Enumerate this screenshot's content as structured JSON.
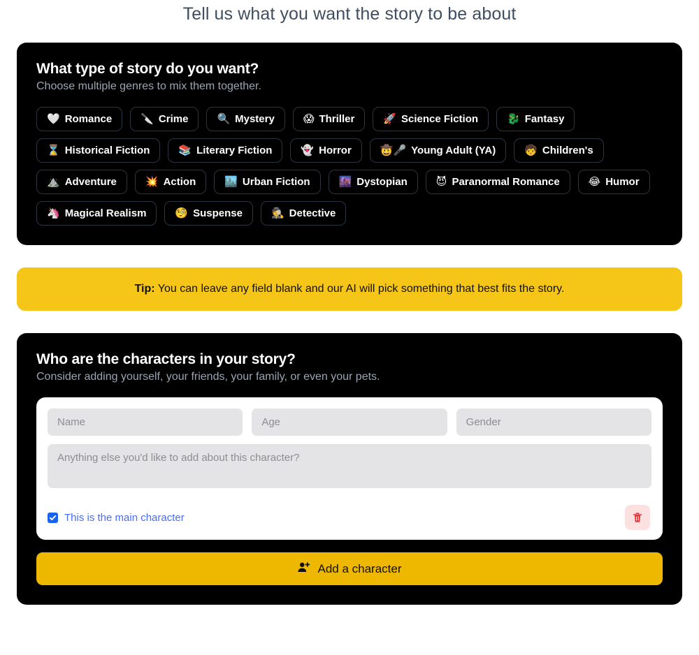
{
  "page": {
    "title": "Tell us what you want the story to be about",
    "background_color": "#ffffff",
    "title_color": "#3f4e60"
  },
  "genre_card": {
    "title": "What type of story do you want?",
    "subtitle": "Choose multiple genres to mix them together.",
    "background_color": "#000000",
    "chip_border_color": "#2c3442",
    "genres": [
      {
        "label": "Romance",
        "emoji": "🤍",
        "icon_name": "white-heart-icon"
      },
      {
        "label": "Crime",
        "emoji": "🔪",
        "icon_name": "knife-icon"
      },
      {
        "label": "Mystery",
        "emoji": "🔍",
        "icon_name": "magnifying-glass-icon"
      },
      {
        "label": "Thriller",
        "emoji": "😱",
        "icon_name": "screaming-face-icon"
      },
      {
        "label": "Science Fiction",
        "emoji": "🚀",
        "icon_name": "rocket-icon"
      },
      {
        "label": "Fantasy",
        "emoji": "🐉",
        "icon_name": "dragon-icon"
      },
      {
        "label": "Historical Fiction",
        "emoji": "⌛",
        "icon_name": "hourglass-icon"
      },
      {
        "label": "Literary Fiction",
        "emoji": "📚",
        "icon_name": "books-icon"
      },
      {
        "label": "Horror",
        "emoji": "👻",
        "icon_name": "ghost-icon"
      },
      {
        "label": "Young Adult (YA)",
        "emoji": "🤠🎤",
        "icon_name": "cowboy-microphone-icon"
      },
      {
        "label": "Children's",
        "emoji": "🧒",
        "icon_name": "child-icon"
      },
      {
        "label": "Adventure",
        "emoji": "⛰️",
        "icon_name": "mountain-icon"
      },
      {
        "label": "Action",
        "emoji": "💥",
        "icon_name": "collision-icon"
      },
      {
        "label": "Urban Fiction",
        "emoji": "🏙️",
        "icon_name": "cityscape-icon"
      },
      {
        "label": "Dystopian",
        "emoji": "🌆",
        "icon_name": "dusk-city-icon"
      },
      {
        "label": "Paranormal Romance",
        "emoji": "😈",
        "icon_name": "devil-face-icon"
      },
      {
        "label": "Humor",
        "emoji": "😂",
        "icon_name": "laughing-face-icon"
      },
      {
        "label": "Magical Realism",
        "emoji": "🦄",
        "icon_name": "unicorn-icon"
      },
      {
        "label": "Suspense",
        "emoji": "🧐",
        "icon_name": "monocle-face-icon"
      },
      {
        "label": "Detective",
        "emoji": "🕵️",
        "icon_name": "detective-icon"
      }
    ]
  },
  "tip": {
    "label": "Tip:",
    "text": " You can leave any field blank and our AI will pick something that best fits the story.",
    "background_color": "#f5c518"
  },
  "characters_card": {
    "title": "Who are the characters in your story?",
    "subtitle": "Consider adding yourself, your friends, your family, or even your pets.",
    "character": {
      "name_placeholder": "Name",
      "name_value": "",
      "age_placeholder": "Age",
      "age_value": "",
      "gender_placeholder": "Gender",
      "gender_value": "",
      "notes_placeholder": "Anything else you'd like to add about this character?",
      "notes_value": "",
      "main_character_label": "This is the main character",
      "main_character_checked": true,
      "checkbox_color": "#1a62f2",
      "label_color": "#4a6cf7",
      "delete_background_color": "#fde1e1",
      "delete_icon_color": "#e8393b"
    },
    "add_button_label": "Add a character",
    "add_button_color": "#eeb800"
  }
}
